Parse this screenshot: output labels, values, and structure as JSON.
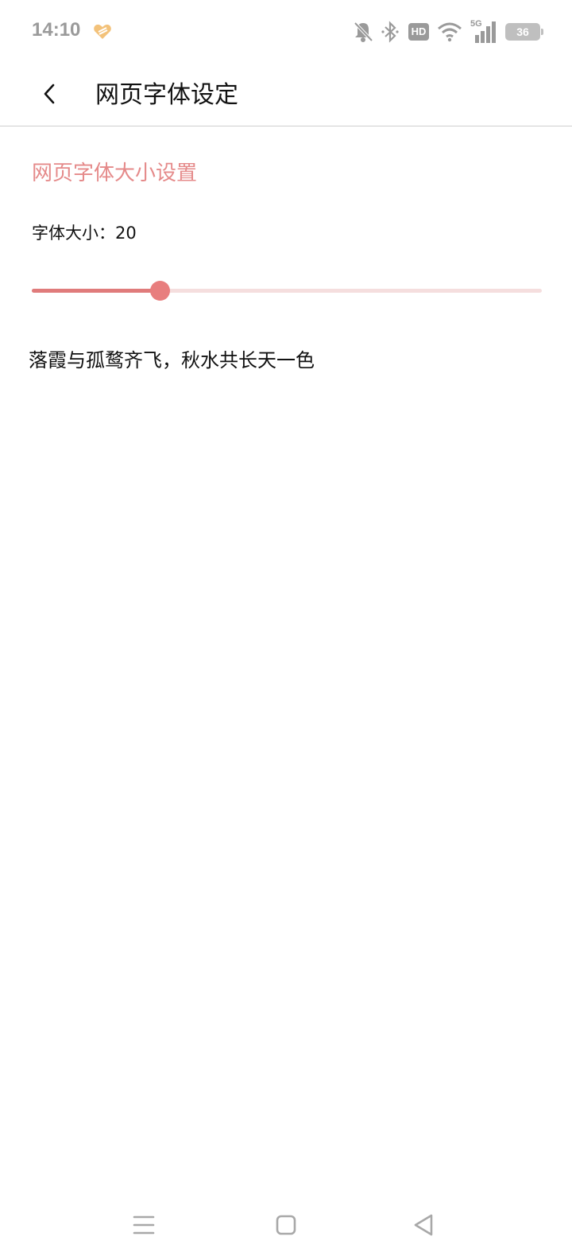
{
  "status_bar": {
    "time": "14:10",
    "hd_label": "HD",
    "network_label": "5G",
    "battery_level": "36"
  },
  "toolbar": {
    "title": "网页字体设定"
  },
  "settings": {
    "section_title": "网页字体大小设置",
    "font_size_label": "字体大小：20",
    "slider_fraction": 0.25,
    "preview_text": "落霞与孤鹜齐飞，秋水共长天一色"
  },
  "colors": {
    "accent": "#e58a8a",
    "slider_fill": "#e07b7b",
    "slider_track": "#f5dede",
    "text": "#111111",
    "status_grey": "#9a9a9a"
  },
  "icons": {
    "back": "chevron-left-icon",
    "mute": "bell-off-icon",
    "bluetooth": "bluetooth-icon",
    "wifi": "wifi-icon",
    "signal": "signal-icon",
    "battery": "battery-icon",
    "nav_menu": "menu-icon",
    "nav_home": "home-icon",
    "nav_back": "back-triangle-icon"
  }
}
